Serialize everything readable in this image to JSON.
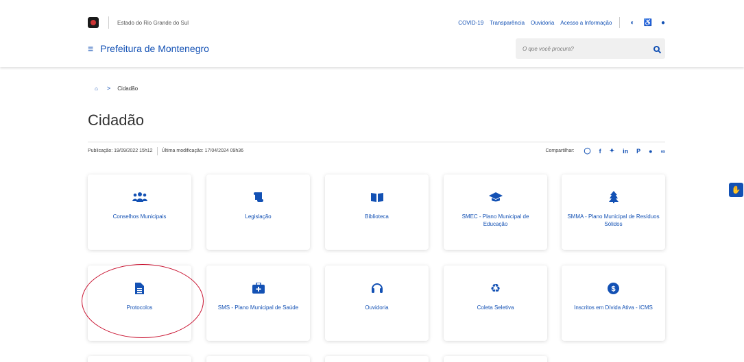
{
  "topbar": {
    "state_name": "Estado do Rio Grande do Sul",
    "links": [
      "COVID-19",
      "Transparência",
      "Ouvidoria",
      "Acesso a Informação"
    ],
    "icons": [
      "contrast-icon",
      "accessibility-icon",
      "cookie-icon"
    ]
  },
  "brandbar": {
    "menu_icon": "hamburger-icon",
    "title": "Prefeitura de Montenegro",
    "search_placeholder": "O que você procura?"
  },
  "breadcrumb": {
    "home_icon": "home-icon",
    "separator": ">",
    "current": "Cidadão"
  },
  "page": {
    "title": "Cidadão",
    "published": "Publicação: 19/09/2022 15h12",
    "modified": "Última modificação: 17/04/2024 09h36",
    "share_label": "Compartilhar:"
  },
  "share_icons": [
    "whatsapp-icon",
    "facebook-icon",
    "twitter-icon",
    "linkedin-icon",
    "pinterest-icon",
    "telegram-icon",
    "link-icon"
  ],
  "cards": [
    {
      "label": "Conselhos Municipais",
      "icon": "users-icon"
    },
    {
      "label": "Legislação",
      "icon": "scroll-icon"
    },
    {
      "label": "Biblioteca",
      "icon": "book-icon"
    },
    {
      "label": "SMEC - Plano Municipal de Educação",
      "icon": "graduation-cap-icon"
    },
    {
      "label": "SMMA - Plano Municipal de Resíduos Sólidos",
      "icon": "tree-icon"
    },
    {
      "label": "Protocolos",
      "icon": "document-icon"
    },
    {
      "label": "SMS - Plano Municipal de Saúde",
      "icon": "medical-kit-icon"
    },
    {
      "label": "Ouvidoria",
      "icon": "headset-icon"
    },
    {
      "label": "Coleta Seletiva",
      "icon": "recycle-icon"
    },
    {
      "label": "Inscritos em Dívida Ativa - ICMS",
      "icon": "money-icon"
    }
  ],
  "colors": {
    "accent": "#1351b4",
    "annotation": "#c8102e"
  }
}
